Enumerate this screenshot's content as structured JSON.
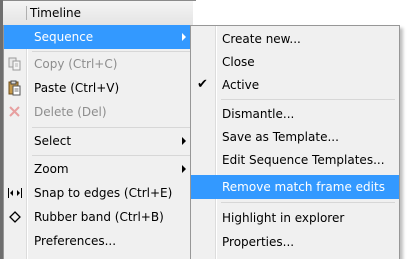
{
  "header": {
    "title": "Timeline"
  },
  "context_menu": {
    "items": [
      {
        "label": "Sequence",
        "submenu": true,
        "highlighted": true
      },
      {
        "label": "Copy (Ctrl+C)",
        "disabled": true,
        "icon": "copy-icon"
      },
      {
        "label": "Paste (Ctrl+V)",
        "icon": "paste-icon"
      },
      {
        "label": "Delete (Del)",
        "disabled": true,
        "icon": "delete-icon"
      },
      {
        "label": "Select",
        "submenu": true
      },
      {
        "label": "Zoom",
        "submenu": true
      },
      {
        "label": "Snap to edges (Ctrl+E)",
        "icon": "snap-icon"
      },
      {
        "label": "Rubber band (Ctrl+B)",
        "icon": "rubber-band-icon"
      },
      {
        "label": "Preferences..."
      }
    ]
  },
  "sequence_submenu": {
    "items": [
      {
        "label": "Create new..."
      },
      {
        "label": "Close"
      },
      {
        "label": "Active",
        "checked": true
      },
      {
        "label": "Dismantle..."
      },
      {
        "label": "Save as Template..."
      },
      {
        "label": "Edit Sequence Templates..."
      },
      {
        "label": "Remove match frame edits",
        "highlighted": true
      },
      {
        "label": "Highlight in explorer"
      },
      {
        "label": "Properties..."
      }
    ]
  },
  "colors": {
    "highlight": "#3399ff",
    "menu_bg": "#f0f0f0",
    "disabled_text": "#8d8d8d"
  }
}
